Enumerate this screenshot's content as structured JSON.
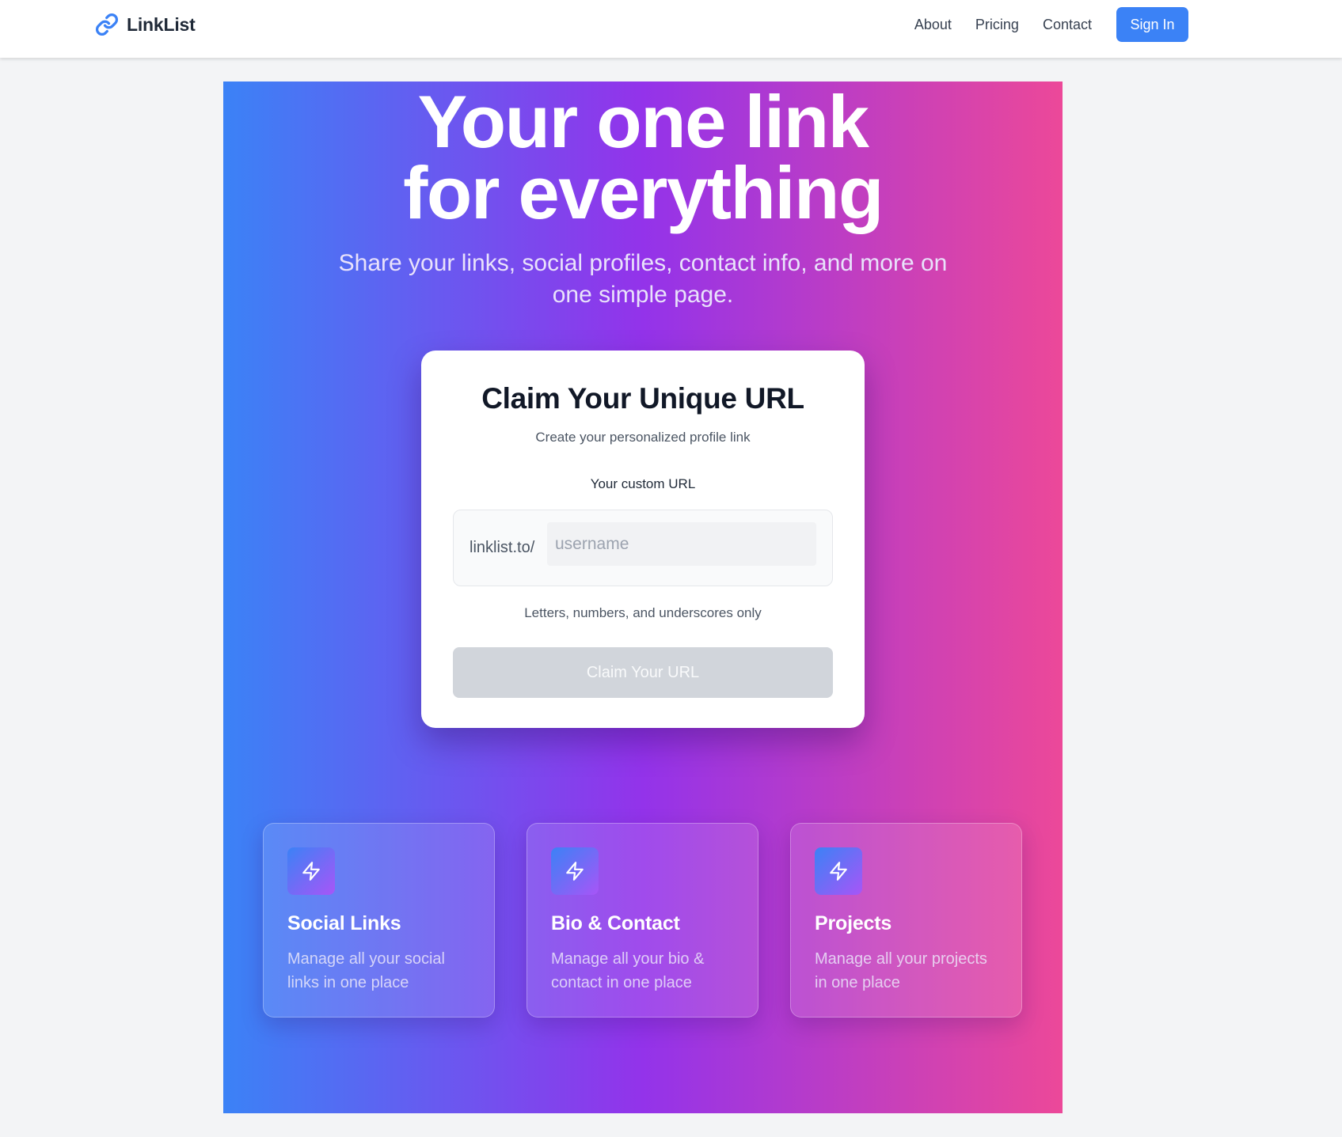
{
  "navbar": {
    "brand": "LinkList",
    "brand_icon": "link-icon",
    "links": [
      "About",
      "Pricing",
      "Contact"
    ],
    "signin_label": "Sign In",
    "accent_color": "#3b82f6"
  },
  "hero": {
    "title_line1": "Your one link",
    "title_line2": "for everything",
    "subtitle": "Share your links, social profiles, contact info, and more on one simple page.",
    "gradient": [
      "#3b82f6",
      "#9333ea",
      "#ec4899"
    ]
  },
  "claim": {
    "title": "Claim Your Unique URL",
    "subtitle": "Create your personalized profile link",
    "field_label": "Your custom URL",
    "prefix": "linklist.to/",
    "input_value": "",
    "input_placeholder": "username",
    "hint": "Letters, numbers, and underscores only",
    "button_label": "Claim Your URL",
    "button_state": "disabled"
  },
  "features": [
    {
      "icon": "lightning-icon",
      "title": "Social Links",
      "description": "Manage all your social links in one place"
    },
    {
      "icon": "lightning-icon",
      "title": "Bio & Contact",
      "description": "Manage all your bio & contact in one place"
    },
    {
      "icon": "lightning-icon",
      "title": "Projects",
      "description": "Manage all your projects in one place"
    }
  ]
}
